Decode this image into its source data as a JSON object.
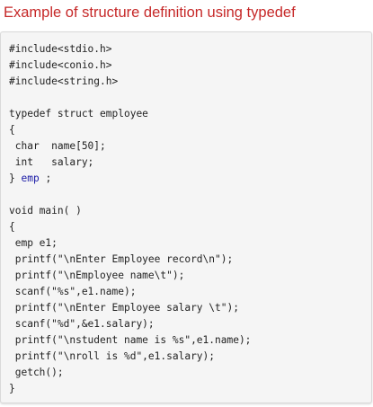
{
  "page": {
    "title": "Example of structure definition using typedef"
  },
  "code": {
    "lines": [
      "#include<stdio.h>",
      "#include<conio.h>",
      "#include<string.h>",
      "",
      "typedef struct employee",
      "{",
      " char  name[50];",
      " int   salary;",
      "} ",
      "",
      "void main( )",
      "{",
      " emp e1;",
      " printf(\"\\nEnter Employee record\\n\");",
      " printf(\"\\nEmployee name\\t\");",
      " scanf(\"%s\",e1.name);",
      " printf(\"\\nEnter Employee salary \\t\");",
      " scanf(\"%d\",&e1.salary);",
      " printf(\"\\nstudent name is %s\",e1.name);",
      " printf(\"\\nroll is %d\",e1.salary);",
      " getch();",
      "}"
    ],
    "typedef_alias": "emp",
    "typedef_terminator": " ;",
    "alias_color": "#1a1aa6",
    "title_color": "#c62828"
  }
}
